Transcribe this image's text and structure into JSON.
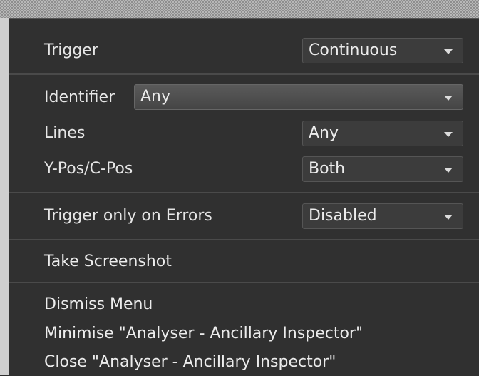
{
  "menu": {
    "trigger": {
      "label": "Trigger",
      "value": "Continuous"
    },
    "identifier": {
      "label": "Identifier",
      "value": "Any"
    },
    "lines": {
      "label": "Lines",
      "value": "Any"
    },
    "ypos": {
      "label": "Y-Pos/C-Pos",
      "value": "Both"
    },
    "errors": {
      "label": "Trigger only on Errors",
      "value": "Disabled"
    },
    "take_screenshot": "Take Screenshot",
    "dismiss": "Dismiss Menu",
    "minimise": "Minimise \"Analyser - Ancillary Inspector\"",
    "close": "Close \"Analyser - Ancillary Inspector\""
  },
  "icons": {
    "dropdown": "chevron-down-icon"
  }
}
